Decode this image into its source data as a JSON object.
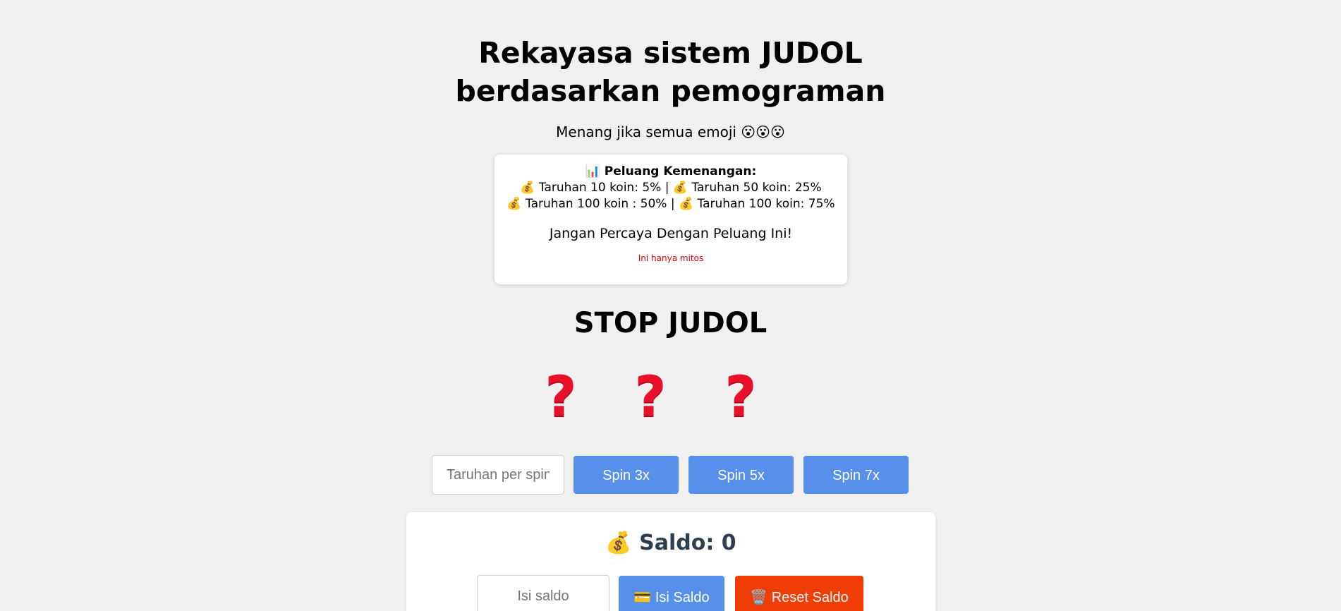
{
  "header": {
    "title": "Rekayasa sistem JUDOL berdasarkan pemograman",
    "subtitle": "Menang jika semua emoji 😮😮😮"
  },
  "odds": {
    "title": "📊 Peluang Kemenangan:",
    "line1": "💰 Taruhan 10 koin: 5% | 💰 Taruhan 50 koin: 25%",
    "line2": "💰 Taruhan 100 koin : 50% | 💰 Taruhan 100 koin: 75%",
    "warning": "Jangan Percaya Dengan Peluang Ini!",
    "note": "Ini hanya mitos"
  },
  "stop_title": "STOP JUDOL",
  "reels": [
    "?",
    "?",
    "?"
  ],
  "controls": {
    "bet_placeholder": "Taruhan per spin",
    "spin3_label": "Spin 3x",
    "spin5_label": "Spin 5x",
    "spin7_label": "Spin 7x"
  },
  "saldo": {
    "label": "💰 Saldo: 0",
    "input_placeholder": "Isi saldo",
    "isi_label": "💳 Isi Saldo",
    "reset_label": "🗑️ Reset Saldo"
  },
  "colors": {
    "spin_button": "#5790eb",
    "reset_button": "#ef3d05",
    "myth_text": "#e60000",
    "saldo_text": "#2c3e50"
  }
}
